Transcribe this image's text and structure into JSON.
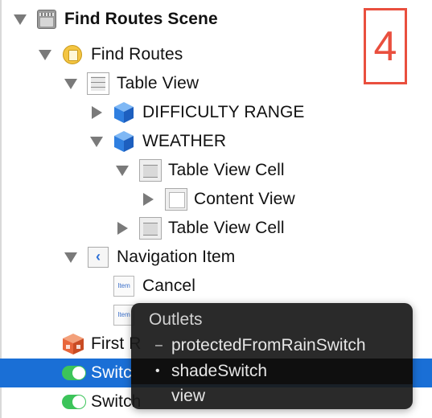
{
  "annotation_number": "4",
  "tree": {
    "scene": "Find Routes Scene",
    "view_controller": "Find Routes",
    "table_view": "Table View",
    "section_difficulty": "DIFFICULTY RANGE",
    "section_weather": "WEATHER",
    "cell_1": "Table View Cell",
    "content_view": "Content View",
    "cell_2": "Table View Cell",
    "navigation_item": "Navigation Item",
    "cancel_item": "Cancel",
    "item_icon_text": "Item",
    "first_responder": "First R",
    "switch_1": "Switc",
    "switch_2": "Switch"
  },
  "popup": {
    "title": "Outlets",
    "items": [
      {
        "label": "protectedFromRainSwitch",
        "marker": "–"
      },
      {
        "label": "shadeSwitch",
        "marker": "•"
      },
      {
        "label": "view",
        "marker": ""
      }
    ]
  },
  "colors": {
    "selection": "#1a6fd6",
    "annotation": "#e94f3e",
    "switch_on": "#3cc45a",
    "popup_bg": "#1a1a1a"
  }
}
